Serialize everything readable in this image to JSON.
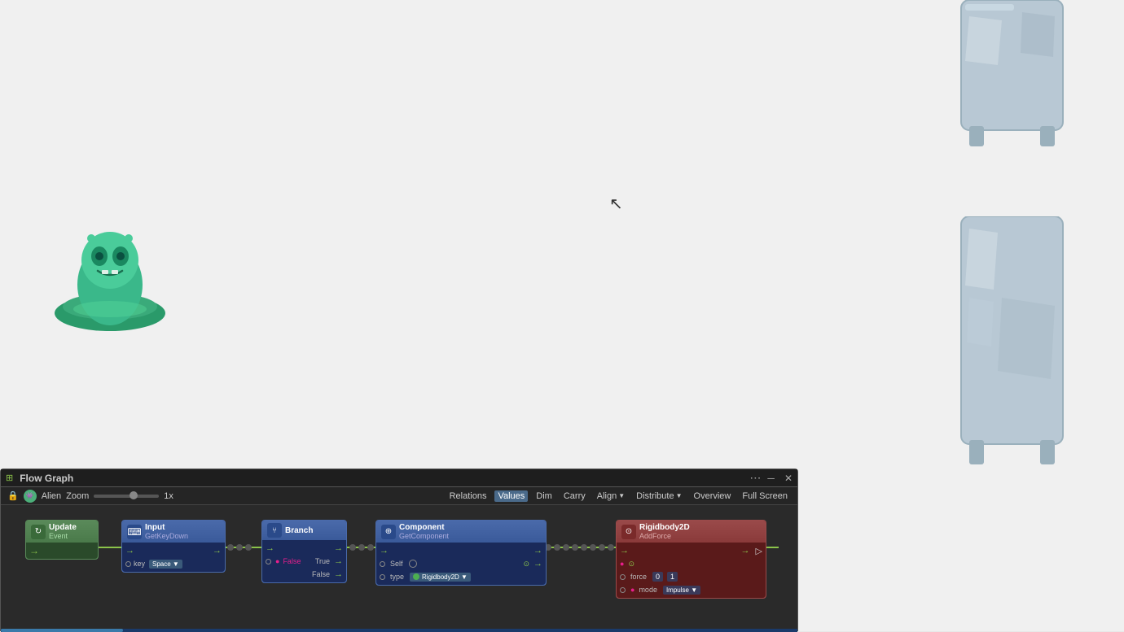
{
  "canvas": {
    "background": "#ebebeb"
  },
  "flowGraph": {
    "title": "Flow Graph",
    "alienLabel": "Alien",
    "zoom": {
      "label": "Zoom",
      "value": "1x"
    },
    "toolbar": {
      "relations": "Relations",
      "values": "Values",
      "dim": "Dim",
      "carry": "Carry",
      "align": "Align",
      "distribute": "Distribute",
      "overview": "Overview",
      "fullScreen": "Full Screen"
    },
    "nodes": [
      {
        "id": "update",
        "title": "Update",
        "subtitle": "Event",
        "iconColor": "#4a9a4a",
        "iconSymbol": "↻"
      },
      {
        "id": "input",
        "title": "Input",
        "subtitle": "GetKeyDown",
        "iconColor": "#3a6aaa",
        "iconSymbol": "⌨"
      },
      {
        "id": "branch",
        "title": "Branch",
        "subtitle": "",
        "iconColor": "#3a6aaa",
        "iconSymbol": "⑂"
      },
      {
        "id": "component",
        "title": "Component",
        "subtitle": "GetComponent",
        "iconColor": "#3a6aaa",
        "iconSymbol": "⊕"
      },
      {
        "id": "rigidbody",
        "title": "Rigidbody2D",
        "subtitle": "AddForce",
        "iconColor": "#aa3a3a",
        "iconSymbol": "⊙"
      }
    ],
    "ports": {
      "keyLabel": "key",
      "keyValue": "Space",
      "selfLabel": "Self",
      "typeLabel": "type",
      "typeValue": "Rigidbody2D",
      "forceLabel": "force",
      "forceValue": "0  1",
      "modeLabel": "mode",
      "modeValue": "Impulse",
      "trueLabel": "True",
      "falseLabel": "False"
    }
  }
}
